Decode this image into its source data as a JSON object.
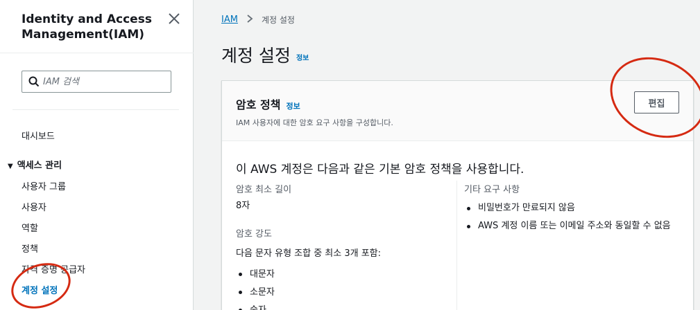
{
  "sidebar": {
    "title": "Identity and Access Management(IAM)",
    "search_placeholder": "IAM 검색",
    "dashboard": "대시보드",
    "section_label": "액세스 관리",
    "items": [
      {
        "label": "사용자 그룹"
      },
      {
        "label": "사용자"
      },
      {
        "label": "역할"
      },
      {
        "label": "정책"
      },
      {
        "label": "자격 증명 공급자"
      },
      {
        "label": "계정 설정"
      }
    ]
  },
  "breadcrumb": {
    "root": "IAM",
    "current": "계정 설정"
  },
  "page": {
    "title": "계정 설정",
    "info": "정보"
  },
  "card": {
    "title": "암호 정책",
    "info": "정보",
    "description": "IAM 사용자에 대한 암호 요구 사항을 구성합니다.",
    "edit_label": "편집",
    "heading": "이 AWS 계정은 다음과 같은 기본 암호 정책을 사용합니다.",
    "min_length_label": "암호 최소 길이",
    "min_length_value": "8자",
    "strength_label": "암호 강도",
    "strength_desc": "다음 문자 유형 조합 중 최소 3개 포함:",
    "strength_items": [
      "대문자",
      "소문자",
      "숫자"
    ],
    "other_label": "기타 요구 사항",
    "other_items": [
      "비밀번호가 만료되지 않음",
      "AWS 계정 이름 또는 이메일 주소와 동일할 수 없음"
    ]
  },
  "colors": {
    "link": "#0073bb",
    "annotation": "#d52a12"
  },
  "icons": {
    "close": "close-icon",
    "search": "search-icon",
    "caret": "caret-down-icon"
  }
}
